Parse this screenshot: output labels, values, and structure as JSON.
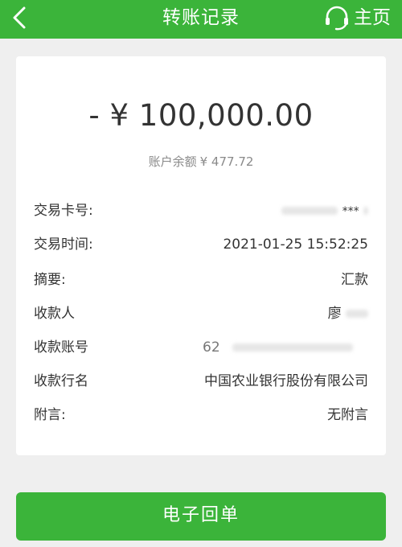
{
  "header": {
    "title": "转账记录",
    "home_label": "主页",
    "back_icon": "chevron-left-icon",
    "support_icon": "headset-icon",
    "color": "#3bb43a"
  },
  "transaction": {
    "amount": "- ¥ 100,000.00",
    "balance_label": "账户余额",
    "balance_value": "¥ 477.72"
  },
  "details": [
    {
      "label": "交易卡号:",
      "value": "***"
    },
    {
      "label": "交易时间:",
      "value": "2021-01-25 15:52:25"
    },
    {
      "label": "摘要:",
      "value": "汇款"
    },
    {
      "label": "收款人",
      "value": "廖"
    },
    {
      "label": "收款账号",
      "value": "62"
    },
    {
      "label": "收款行名",
      "value": "中国农业银行股份有限公司"
    },
    {
      "label": "附言:",
      "value": "无附言"
    }
  ],
  "actions": {
    "receipt_label": "电子回单"
  }
}
